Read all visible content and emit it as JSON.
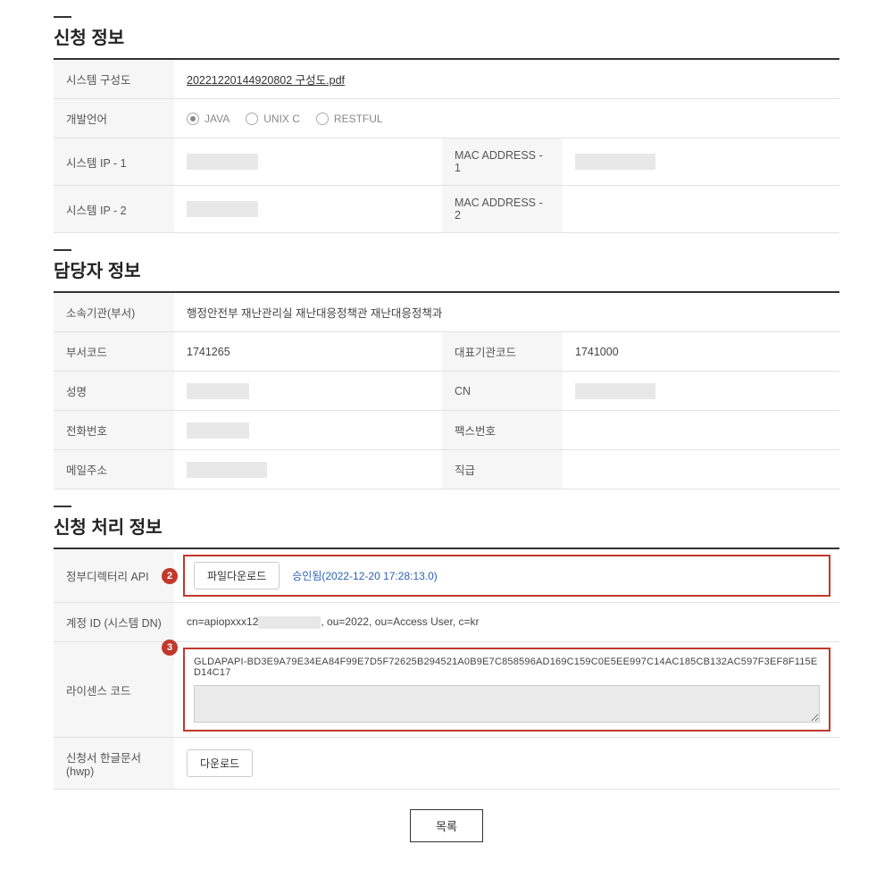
{
  "sections": {
    "application": {
      "title": "신청 정보",
      "system_diagram_label": "시스템 구성도",
      "system_diagram_file": "20221220144920802 구성도.pdf",
      "dev_lang_label": "개발언어",
      "dev_lang_options": {
        "java": "JAVA",
        "unixc": "UNIX C",
        "restful": "RESTFUL"
      },
      "system_ip1_label": "시스템 IP - 1",
      "mac1_label": "MAC ADDRESS - 1",
      "system_ip2_label": "시스템 IP - 2",
      "mac2_label": "MAC ADDRESS - 2"
    },
    "manager": {
      "title": "담당자 정보",
      "org_label": "소속기관(부서)",
      "org_value": "행정안전부 재난관리실 재난대응정책관 재난대응정책과",
      "dept_code_label": "부서코드",
      "dept_code_value": "1741265",
      "rep_org_code_label": "대표기관코드",
      "rep_org_code_value": "1741000",
      "name_label": "성명",
      "cn_label": "CN",
      "phone_label": "전화번호",
      "fax_label": "팩스번호",
      "email_label": "메일주소",
      "position_label": "직급"
    },
    "processing": {
      "title": "신청 처리 정보",
      "api_label": "정부디렉터리 API",
      "api_download_btn": "파일다운로드",
      "api_status": "승인됨(2022-12-20 17:28:13.0)",
      "account_label": "계정 ID (시스템 DN)",
      "account_prefix": "cn=apiopxxx12",
      "account_suffix": ", ou=2022, ou=Access User, c=kr",
      "license_label": "라이센스 코드",
      "license_value": "GLDAPAPI-BD3E9A79E34EA84F99E7D5F72625B294521A0B9E7C858596AD169C159C0E5EE997C14AC185CB132AC597F3EF8F115ED14C17",
      "hwp_label": "신청서 한글문서(hwp)",
      "hwp_download_btn": "다운로드",
      "badge2": "2",
      "badge3": "3"
    }
  },
  "footer": {
    "list_btn": "목록"
  }
}
